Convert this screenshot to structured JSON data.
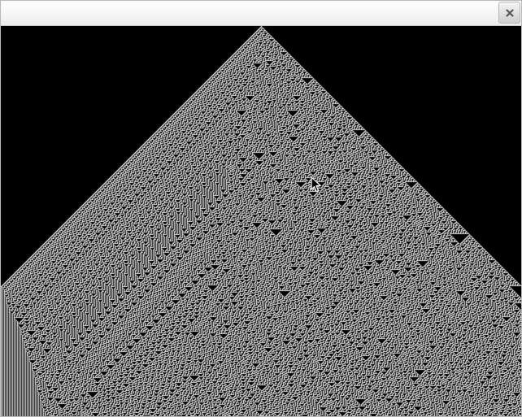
{
  "window": {
    "title": "",
    "close_glyph": "×"
  },
  "canvas": {
    "description_key": "cellular-automaton-render",
    "background_color": "#000000",
    "cell_on_color": "#ffffff",
    "cell_off_color": "#000000"
  },
  "icons": {
    "close": "close-icon",
    "cursor": "mouse-pointer-icon"
  }
}
